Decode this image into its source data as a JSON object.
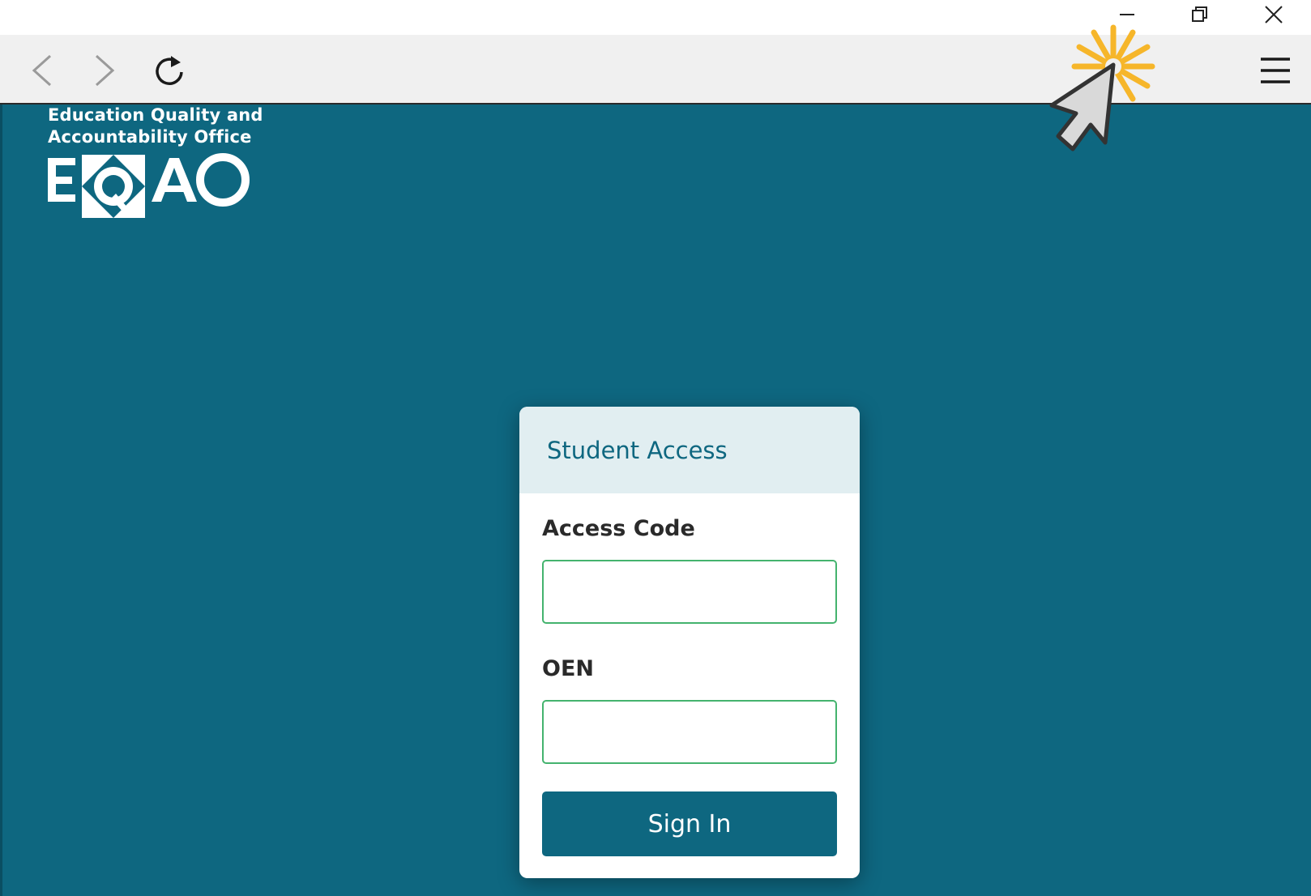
{
  "window": {
    "controls": [
      "minimize-icon",
      "restore-icon",
      "close-icon"
    ]
  },
  "toolbar": {
    "icons": [
      "back-icon",
      "forward-icon",
      "reload-icon",
      "menu-icon"
    ]
  },
  "logo": {
    "line1": "Education Quality and",
    "line2": "Accountability Office",
    "mark": "EQAO"
  },
  "login": {
    "title": "Student Access",
    "access_code_label": "Access Code",
    "access_code_value": "",
    "oen_label": "OEN",
    "oen_value": "",
    "submit_label": "Sign In"
  },
  "colors": {
    "page_background": "#0e6780",
    "card_header": "#e1eef1",
    "input_border": "#44b36e",
    "button": "#0e6780",
    "cursor_highlight": "#f6b62a"
  }
}
